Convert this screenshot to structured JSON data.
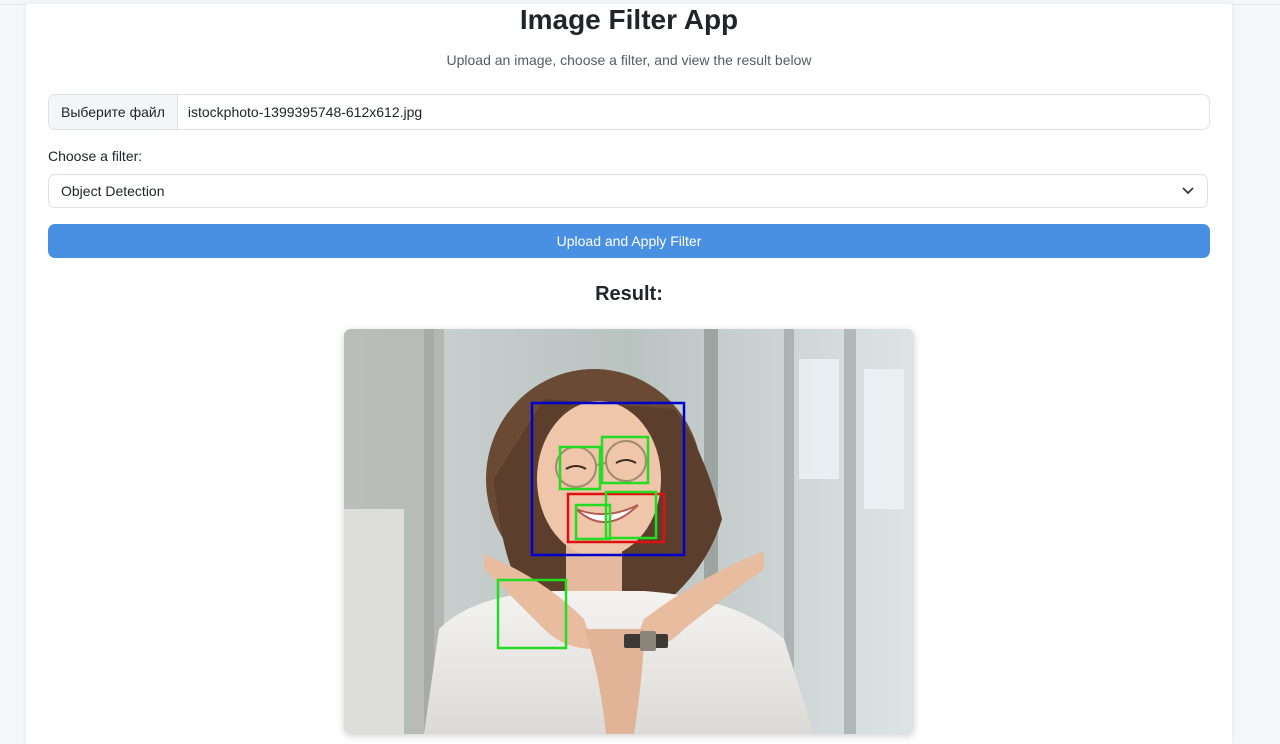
{
  "app": {
    "title": "Image Filter App",
    "subtitle": "Upload an image, choose a filter, and view the result below"
  },
  "upload": {
    "choose_file_label": "Выберите файл",
    "file_name": "istockphoto-1399395748-612x612.jpg"
  },
  "filter": {
    "label": "Choose a filter:",
    "selected": "Object Detection"
  },
  "actions": {
    "apply_label": "Upload and Apply Filter"
  },
  "result": {
    "heading": "Result:",
    "image_description": "Photo of smiling woman with glasses making a chin pose, annotated with detection boxes"
  },
  "colors": {
    "primary_button": "#4a90e2",
    "face_box": "#0000cc",
    "eye_box": "#22dd22",
    "mouth_box": "#e01010"
  }
}
